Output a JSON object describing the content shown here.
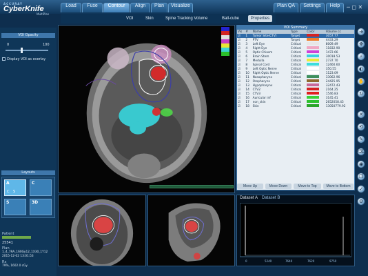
{
  "app": {
    "brand_small": "ACCURAY",
    "brand": "CyberKnife",
    "brand_sub": "MultiPlan"
  },
  "tabs": [
    "Load",
    "Fuse",
    "Contour",
    "Align",
    "Plan",
    "Visualize"
  ],
  "active_tab": "Contour",
  "right_tabs": [
    "Plan QA",
    "Settings",
    "Help"
  ],
  "subtabs": [
    "VOI",
    "Skin",
    "Spine Tracking Volume",
    "Ball-cube"
  ],
  "properties_label": "Properties",
  "left_panel": {
    "opacity_header": "VOI Opacity",
    "slider_min": "0",
    "slider_max": "100",
    "opacity_level": 0.35,
    "overlay_label": "Display VOI as overlay",
    "layouts_header": "Layouts",
    "layout_letters": [
      "A",
      "C",
      "S",
      "3D"
    ],
    "layout_sub": [
      "C",
      "S"
    ],
    "patient_label": "Patient",
    "patient_id": "25541",
    "plan_label": "Plan",
    "plan_name": "1_4_7RA_160Gy12_1X30_1Y12",
    "plan_date": "2015-12-02 13:01:53",
    "rx_label": "Rx",
    "rx_value": "79%, 1602.0 cGy"
  },
  "voi_panel": {
    "title": "VOI Summary",
    "columns": [
      "Vis",
      "#",
      "Name",
      "Type",
      "Color",
      "Volume cc"
    ],
    "rows": [
      {
        "n": "1",
        "name": "Tumor Site(CTV)",
        "type": "Target",
        "color": "#d42222",
        "vol": "3057.77",
        "sel": true
      },
      {
        "n": "2",
        "name": "PTV",
        "type": "Target",
        "color": "#f07d2b",
        "vol": "4433.29"
      },
      {
        "n": "3",
        "name": "Left Eye",
        "type": "Critical",
        "color": "#e8e6e6",
        "vol": "8009.49"
      },
      {
        "n": "4",
        "name": "Right Eye",
        "type": "Critical",
        "color": "#f0a8c4",
        "vol": "11832.90"
      },
      {
        "n": "5",
        "name": "Optic Chiasm",
        "type": "Critical",
        "color": "#d040d8",
        "vol": "1472.66"
      },
      {
        "n": "6",
        "name": "Brain Stem",
        "type": "Critical",
        "color": "#38d2e0",
        "vol": "30018.53"
      },
      {
        "n": "7",
        "name": "Medulla",
        "type": "Critical",
        "color": "#ecec34",
        "vol": "2737.70"
      },
      {
        "n": "8",
        "name": "Spinal Cord",
        "type": "Critical",
        "color": "#3cdede",
        "vol": "12460.60"
      },
      {
        "n": "9",
        "name": "Left Optic Nerve",
        "type": "Critical",
        "color": "#ffffff",
        "vol": "350.55"
      },
      {
        "n": "10",
        "name": "Right Optic Nerve",
        "type": "Critical",
        "color": "#ffffff",
        "vol": "1123.09"
      },
      {
        "n": "11",
        "name": "Nasopharynx",
        "type": "Critical",
        "color": "#3e8f5e",
        "vol": "33062.96"
      },
      {
        "n": "12",
        "name": "Oropharynx",
        "type": "Critical",
        "color": "#8f6a2e",
        "vol": "24425.95"
      },
      {
        "n": "13",
        "name": "Hypopharynx",
        "type": "Critical",
        "color": "#c86a9a",
        "vol": "32472.43"
      },
      {
        "n": "14",
        "name": "CTV2",
        "type": "Critical",
        "color": "#d42222",
        "vol": "2164.25"
      },
      {
        "n": "15",
        "name": "CTV3",
        "type": "Critical",
        "color": "#e02020",
        "vol": "1546.83"
      },
      {
        "n": "16",
        "name": "Auricular inf",
        "type": "Critical",
        "color": "#3ad23a",
        "vol": "3145.41"
      },
      {
        "n": "17",
        "name": "non_skin",
        "type": "Critical",
        "color": "#2dc22d",
        "vol": "2652058.45"
      },
      {
        "n": "18",
        "name": "Skin",
        "type": "Critical",
        "color": "#2aa52a",
        "vol": "13050779.92"
      }
    ],
    "buttons": [
      "Move Up",
      "Move Down",
      "Move to Top",
      "Move to Bottom"
    ]
  },
  "dataset_tabs": [
    "Dataset A",
    "Dataset B"
  ],
  "histogram": {
    "ticks": [
      "0",
      "5240",
      "7640",
      "7620",
      "9750"
    ]
  },
  "colors": {
    "accent": "#3f77ab",
    "selected_row": "#2f6aa7"
  },
  "icons": [
    "arrow-circle-icon",
    "navigate-icon",
    "zoom-icon",
    "window-level-icon",
    "pan-icon",
    "rotate-icon",
    "measure-icon",
    "reset-icon",
    "contour-pen-icon",
    "erase-icon",
    "fill-icon",
    "copy-icon",
    "check-icon",
    "settings-icon"
  ]
}
